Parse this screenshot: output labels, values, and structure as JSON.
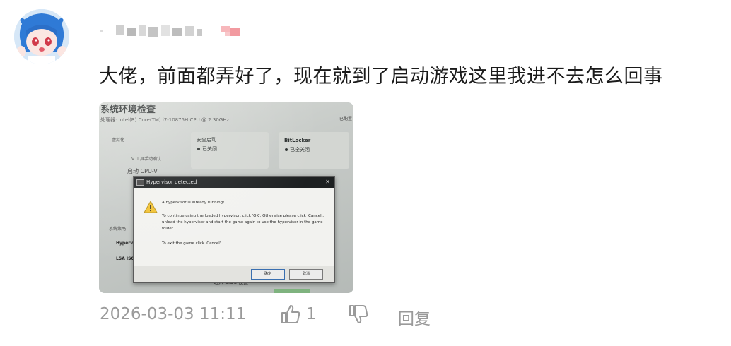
{
  "comment": {
    "text": "大佬，前面都弄好了，现在就到了启动游戏这里我进不去怎么回事",
    "timestamp": "2026-03-03 11:11",
    "like_count": "1",
    "reply_label": "回复"
  },
  "photo": {
    "heading": "系统环境检查",
    "cpu_line": "处理器: Intel(R) Core(TM) i7-10875H CPU @ 2.30GHz",
    "top_badge": "已配置",
    "panels": [
      {
        "title": "安全启动",
        "status": "已关闭"
      },
      {
        "title": "BitLocker",
        "status": "已全关闭"
      }
    ],
    "left_items": [
      "虚拟化",
      "…V 工具手动确认",
      "启动 CPU-V",
      "系统策略",
      "Hyperv… hyperv…",
      "LSA ISO… loadop…"
    ],
    "bottom_link": "进入 BIOS 设置",
    "dialog": {
      "title": "Hypervisor detected",
      "line1": "A hypervisor is already running!",
      "line2": "To continue using the loaded hypervisor, click 'OK'. Otherwise please click 'Cancel', unload the hypervisor and start the game again to use the hypervisor in the game folder.",
      "line3": "To exit the game click 'Cancel'",
      "ok_label": "确定",
      "cancel_label": "取消",
      "close_glyph": "✕"
    }
  },
  "colors": {
    "comment_text": "#1a1a1a",
    "meta_text": "#9a9a9a",
    "username_red": "#f29aa0"
  },
  "icons": [
    "avatar",
    "thumbs-up-icon",
    "thumbs-down-icon",
    "warning-icon"
  ]
}
